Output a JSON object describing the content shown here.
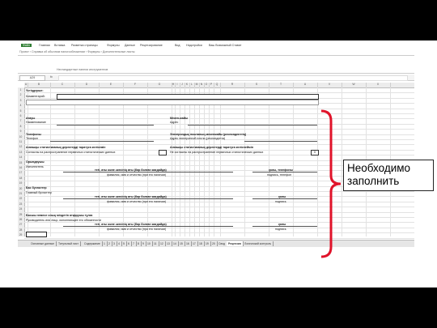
{
  "ribbon": {
    "file_tab": "Файл",
    "tabs": [
      "Главная",
      "Вставка",
      "Разметка страницы",
      "Формулы",
      "Данные",
      "Рецензирование",
      "Вид",
      "Надстройки",
      "Ваш Возможный Ставит"
    ],
    "breadcrumb": "Проект › Справка об обычном налогообложении › Формулы › Дополнительные листы"
  },
  "toolbar": {
    "caption": "Нестандартные панели инструментов"
  },
  "formula_bar": {
    "name_box": "A29",
    "fx": "fx",
    "formula": ""
  },
  "columns": [
    "A",
    "B",
    "C",
    "D",
    "E",
    "F",
    "G",
    "H",
    "I",
    "J",
    "K",
    "L",
    "M",
    "N",
    "O",
    "P",
    "Q",
    "R",
    "S",
    "T",
    "U",
    "V",
    "W",
    "X"
  ],
  "rows": [
    "1",
    "2",
    "3",
    "4",
    "5",
    "6",
    "7",
    "8",
    "9",
    "10",
    "11",
    "12",
    "13",
    "14",
    "15",
    "16",
    "17",
    "18",
    "19",
    "20",
    "21",
    "22",
    "23",
    "24",
    "25",
    "26",
    "27",
    "28",
    "29"
  ],
  "form": {
    "approver_label": "Үстіңдерше:",
    "comment_label": "Комментарий:",
    "name_kz": "Атауы",
    "name_ru": "Наименование",
    "address_kz": "Мекен-жайы",
    "address_ru": "Адрес",
    "phone_kz": "Телефоны",
    "phone_ru": "Телефон",
    "email_kz": "Электрондық поштаның мекенжайы (респонденттің)",
    "email_ru": "Адрес электронной почты (респондента)",
    "consent_kz": "Алғашқы статистикалық деректерді таратуға келісемін",
    "consent_ru": "Согласны на распространение первичных статистических данных",
    "refuse_kz": "Алғашқы статистикалық деректерді таратуға келіспеймін",
    "refuse_ru": "Не согласны на распространение первичных статистических данных",
    "refuse_mark": "X",
    "executor_kz": "Орындаушы",
    "executor_ru": "Исполнитель",
    "fio_kz": "тегі, аты және әкесінің аты (бар болған жағдайда)",
    "fio_ru": "фамилия, имя и отчество (при его наличии)",
    "sign_phone_kz": "қолы, телефоны",
    "sign_phone_ru": "подпись, телефон",
    "chief_acc_kz": "Бас бухгалтер",
    "chief_acc_ru": "Главный бухгалтер",
    "sign_kz": "қолы",
    "sign_ru": "подпись",
    "head_kz": "Басшы немесе оның міндетін атқарушы тұлға",
    "head_ru": "Руководитель или лицо, исполняющее его обязанности"
  },
  "sheet_tabs": [
    "Основные данные",
    "Титульный лист",
    "Содержание",
    "1",
    "2",
    "3",
    "4",
    "5",
    "6",
    "7",
    "8",
    "9",
    "10",
    "11",
    "12",
    "13",
    "14",
    "15",
    "16",
    "17",
    "18",
    "19",
    "20",
    "Свод",
    "Рецензия",
    "Логический контроль"
  ],
  "active_sheet": "Рецензия",
  "callout": {
    "line1": "Необходимо",
    "line2": "заполнить"
  },
  "colors": {
    "bracket": "#e0132a",
    "ribbon_green": "#2e7d32"
  }
}
